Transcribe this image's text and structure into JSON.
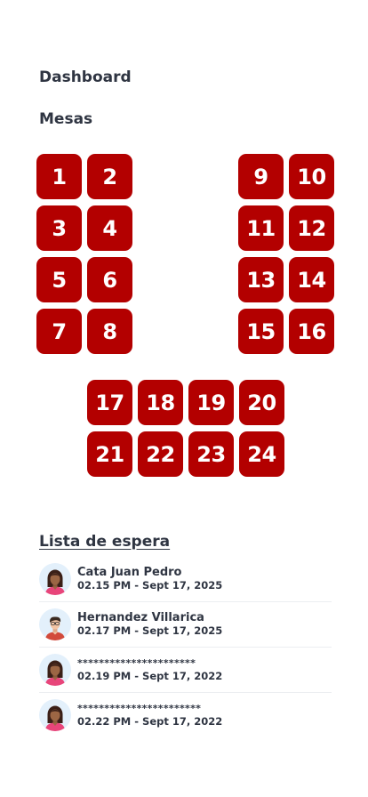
{
  "header": {
    "title": "Dashboard",
    "section_title": "Mesas"
  },
  "tables": {
    "left": [
      "1",
      "2",
      "3",
      "4",
      "5",
      "6",
      "7",
      "8"
    ],
    "right": [
      "9",
      "10",
      "11",
      "12",
      "13",
      "14",
      "15",
      "16"
    ],
    "bottom": [
      "17",
      "18",
      "19",
      "20",
      "21",
      "22",
      "23",
      "24"
    ],
    "color": "#b30000"
  },
  "waitlist": {
    "title": "Lista de espera",
    "items": [
      {
        "name": "Cata Juan Pedro",
        "time": "02.15 PM - Sept 17, 2025",
        "avatar": "woman-avatar-icon"
      },
      {
        "name": "Hernandez Villarica",
        "time": "02.17 PM - Sept 17, 2025",
        "avatar": "man-avatar-icon"
      },
      {
        "name": "**********************",
        "time": "02.19 PM - Sept 17, 2022",
        "avatar": "woman-avatar-icon"
      },
      {
        "name": "***********************",
        "time": "02.22 PM - Sept 17, 2022",
        "avatar": "woman-avatar-icon"
      }
    ]
  }
}
